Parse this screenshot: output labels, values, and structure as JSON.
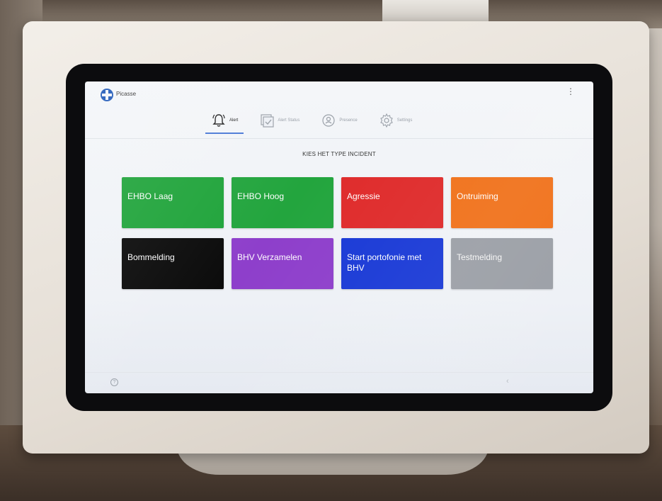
{
  "app": {
    "title": "Picasse"
  },
  "tabs": [
    {
      "label": "Alert",
      "icon": "bell-icon",
      "active": true
    },
    {
      "label": "Alert Status",
      "icon": "checkbox-icon",
      "active": false
    },
    {
      "label": "Presence",
      "icon": "person-icon",
      "active": false
    },
    {
      "label": "Settings",
      "icon": "gear-icon",
      "active": false
    }
  ],
  "main": {
    "heading": "KIES HET TYPE INCIDENT"
  },
  "tiles": [
    {
      "label": "EHBO Laag",
      "color": "#20a43b"
    },
    {
      "label": "EHBO Hoog",
      "color": "#23a53e"
    },
    {
      "label": "Agressie",
      "color": "#df2b2b"
    },
    {
      "label": "Ontruiming",
      "color": "#f0711a"
    },
    {
      "label": "Bommelding",
      "color": "#0b0b0b"
    },
    {
      "label": "BHV Verzamelen",
      "color": "#8e3fcb"
    },
    {
      "label": "Start portofonie met BHV",
      "color": "#1939d6"
    },
    {
      "label": "Testmelding",
      "color": "#9b9fa6"
    }
  ],
  "bottom": {
    "help_icon": "question-icon",
    "back_icon": "back-chevron-icon"
  }
}
